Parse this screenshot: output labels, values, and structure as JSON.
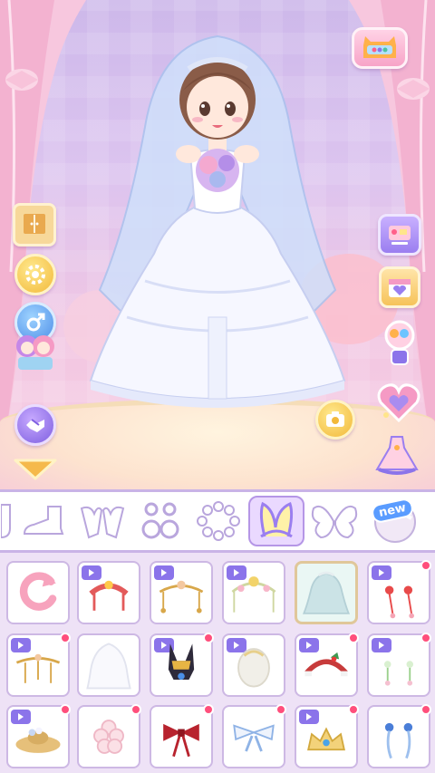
{
  "app": {
    "title": ""
  },
  "colors": {
    "accent": "#b596e6",
    "panel_border": "#cdb8e4",
    "grid_bg": "#eee2f6",
    "ad_badge": "#8b74ea",
    "notify_dot": "#ff4f7c",
    "floor": "#fde3cf"
  },
  "scene": {
    "character_outfit": "wedding-dress",
    "left_buttons": [
      "wardrobe-icon",
      "settings-gear-icon",
      "gender-swap-icon",
      "characters-icon",
      "handshake-icon",
      "collapse-arrow-icon"
    ],
    "right_buttons": [
      "tv-shop-icon",
      "calendar-heart-icon",
      "gift-shop-icon",
      "heart-box-icon",
      "dress-preset-icon"
    ],
    "top_right_button": "game-console-icon",
    "camera_button": "camera-icon"
  },
  "category_bar": {
    "tabs": [
      {
        "icon": "socks-icon",
        "active": false
      },
      {
        "icon": "shoe-icon",
        "active": false
      },
      {
        "icon": "gloves-icon",
        "active": false
      },
      {
        "icon": "earrings-icon",
        "active": false
      },
      {
        "icon": "necklace-icon",
        "active": false
      },
      {
        "icon": "headband-ears-icon",
        "active": true
      },
      {
        "icon": "wings-icon",
        "active": false
      },
      {
        "icon": "new-item-icon",
        "active": false
      }
    ],
    "new_label": "new"
  },
  "items": {
    "row1": [
      {
        "icon": "reset-icon",
        "ad": false,
        "dot": false
      },
      {
        "icon": "red-crown-icon",
        "ad": true,
        "dot": false
      },
      {
        "icon": "gold-tiara-chain-icon",
        "ad": true,
        "dot": false
      },
      {
        "icon": "flower-tiara-icon",
        "ad": true,
        "dot": false
      },
      {
        "icon": "bridal-veil-icon",
        "ad": false,
        "dot": false,
        "selected": true
      },
      {
        "icon": "red-hairpin-icon",
        "ad": true,
        "dot": true
      }
    ],
    "row2": [
      {
        "icon": "pearl-chain-icon",
        "ad": true,
        "dot": true
      },
      {
        "icon": "white-veil-icon",
        "ad": false,
        "dot": false
      },
      {
        "icon": "anubis-headdress-icon",
        "ad": true,
        "dot": true
      },
      {
        "icon": "white-hood-icon",
        "ad": true,
        "dot": false
      },
      {
        "icon": "holly-headband-icon",
        "ad": true,
        "dot": true
      },
      {
        "icon": "flower-pins-icon",
        "ad": true,
        "dot": true
      }
    ],
    "row3": [
      {
        "icon": "straw-hat-icon",
        "ad": true,
        "dot": true
      },
      {
        "icon": "flower-clip-icon",
        "ad": false,
        "dot": true
      },
      {
        "icon": "red-bow-icon",
        "ad": false,
        "dot": true
      },
      {
        "icon": "blue-bow-icon",
        "ad": false,
        "dot": true
      },
      {
        "icon": "gold-crown-icon",
        "ad": true,
        "dot": true
      },
      {
        "icon": "blue-ribbon-pins-icon",
        "ad": false,
        "dot": true
      }
    ]
  }
}
